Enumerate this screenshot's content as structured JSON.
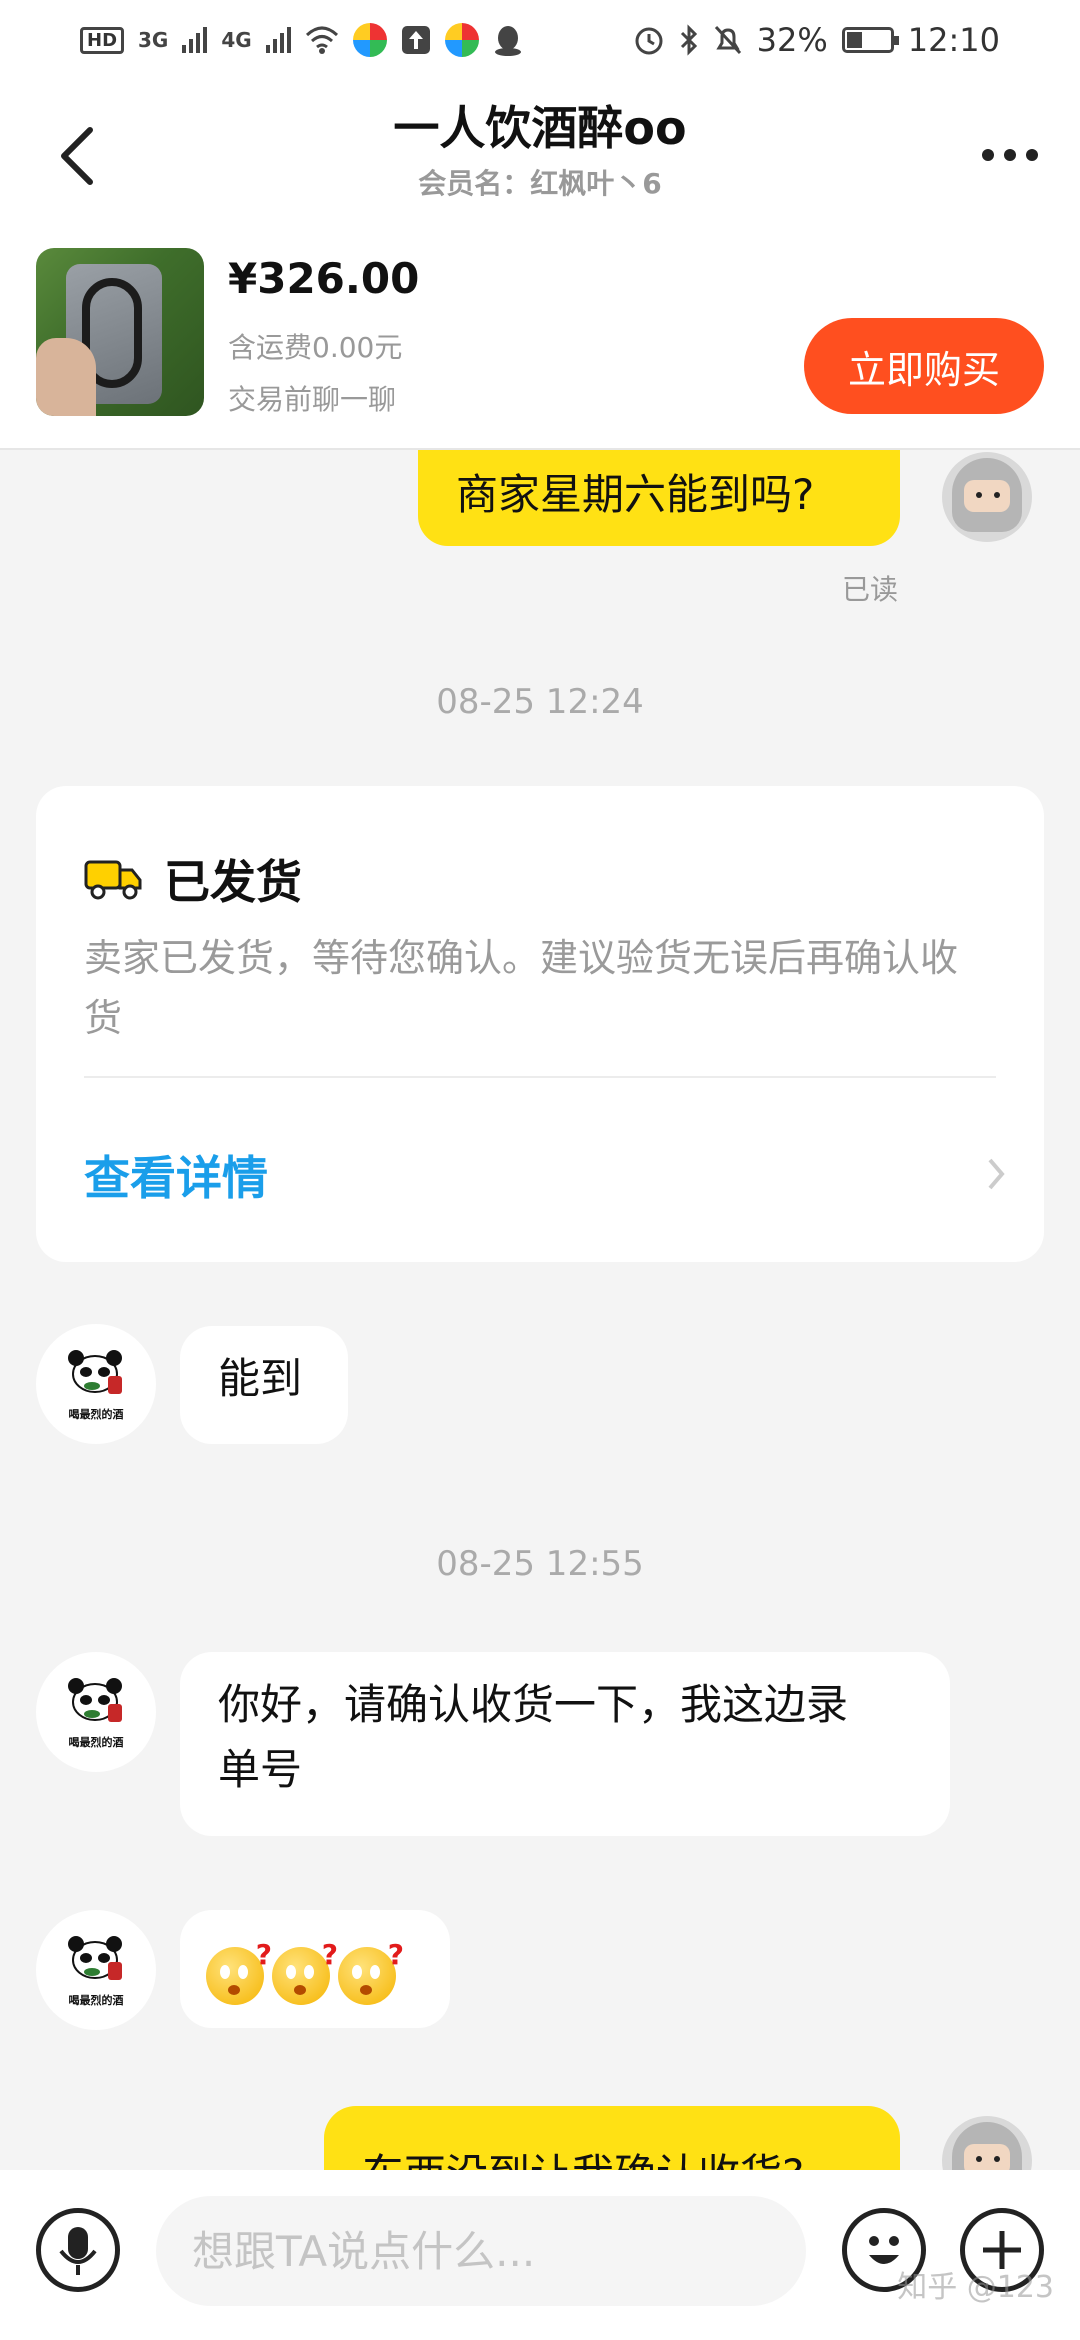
{
  "status_bar": {
    "hd": "HD",
    "sim1": "3G",
    "sim2": "4G",
    "battery_percent": "32%",
    "battery_fraction": 0.32,
    "time": "12:10"
  },
  "header": {
    "title": "一人饮酒醉oo",
    "subtitle": "会员名：红枫叶丶6"
  },
  "product": {
    "price": "¥326.00",
    "shipping": "含运费0.00元",
    "tip": "交易前聊一聊",
    "buy_label": "立即购买"
  },
  "chat": {
    "msg1": "商家星期六能到吗?",
    "read_label": "已读",
    "time1": "08-25 12:24",
    "card": {
      "title": "已发货",
      "desc": "卖家已发货，等待您确认。建议验货无误后再确认收货",
      "link": "查看详情"
    },
    "msg2": "能到",
    "time2": "08-25 12:55",
    "msg3": "你好，请确认收货一下，我这边录单号",
    "msg4_emojis": [
      "confused-face-icon",
      "confused-face-icon",
      "confused-face-icon"
    ],
    "msg5": "东西没到让我确认收货?",
    "avatar_caption": "喝最烈的酒"
  },
  "input": {
    "placeholder": "想跟TA说点什么..."
  },
  "watermark": "知乎 @123",
  "colors": {
    "accent_yellow": "#ffe114",
    "buy_orange": "#ff4f1f",
    "link_blue": "#1a9eea",
    "truck_yellow": "#ffd000"
  }
}
